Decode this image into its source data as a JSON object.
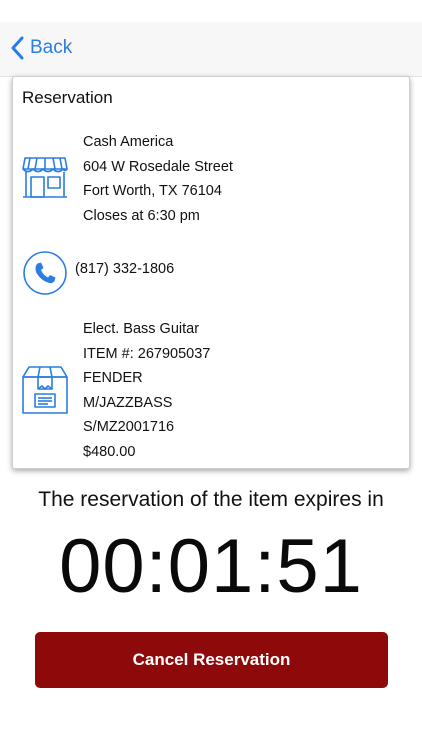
{
  "nav": {
    "back_label": "Back"
  },
  "card": {
    "title": "Reservation",
    "store": {
      "name": "Cash America",
      "address": "604 W Rosedale Street",
      "city": "Fort Worth, TX 76104",
      "hours": "Closes at 6:30 pm"
    },
    "phone": "(817) 332-1806",
    "item": {
      "description": "Elect. Bass Guitar",
      "item_number": "ITEM #: 267905037",
      "brand": "FENDER",
      "model": "M/JAZZBASS",
      "serial": "S/MZ2001716",
      "price": "$480.00"
    }
  },
  "expiry": {
    "label": "The reservation of the item expires in",
    "countdown": "00:01:51"
  },
  "actions": {
    "cancel_label": "Cancel Reservation"
  },
  "colors": {
    "accent": "#2a7de1",
    "cancel_button": "#8e0a0a"
  },
  "icons": {
    "back": "chevron-left-icon",
    "store": "storefront-icon",
    "phone": "phone-icon",
    "item": "package-icon"
  }
}
